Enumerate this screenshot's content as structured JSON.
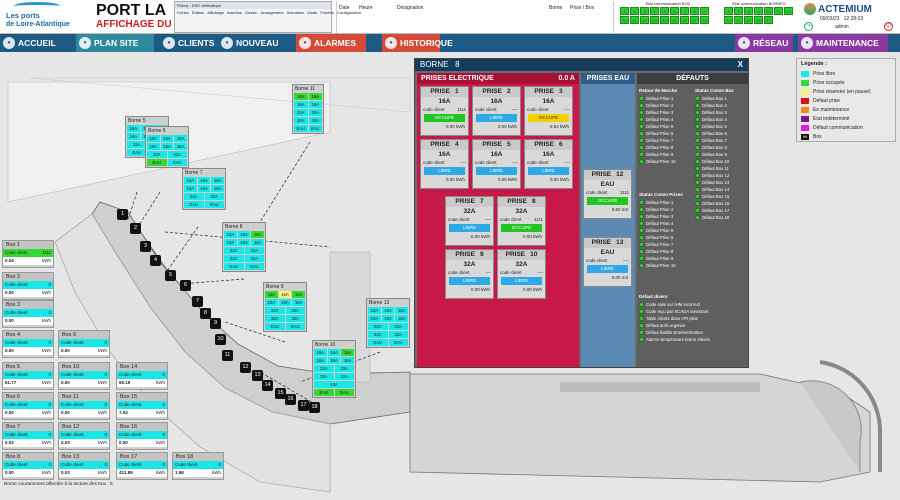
{
  "header": {
    "logo_line1": "Les ports",
    "logo_line2": "de Loire-Atlantique",
    "title": "PORT LA",
    "subtitle": "AFFICHAGE DU",
    "appwin_title": "RView - ERC Méthalique",
    "appwin_menu": [
      "Fichier",
      "Edition",
      "Affichage",
      "Insertion",
      "Dessin",
      "Arrangement",
      "Animation",
      "Mode",
      "Fenêtre",
      "Configuration"
    ],
    "cols": [
      "Date",
      "Heure",
      "Désignation",
      "Borne",
      "Prise / Box"
    ],
    "etat_box_label": "Etat communication BOX",
    "etat_bornes_label": "Etat communication BORNES",
    "box_nums": [
      "1",
      "2",
      "3",
      "4",
      "5",
      "6",
      "7",
      "8",
      "9",
      "10",
      "11",
      "12",
      "13",
      "14",
      "15",
      "16",
      "17",
      "18"
    ],
    "borne_nums": [
      "6",
      "7",
      "8",
      "9",
      "10",
      "11",
      "12",
      "13",
      "14",
      "15",
      "16",
      "17"
    ],
    "brand": "ACTEMIUM",
    "date": "09/03/23",
    "time": "12:28:03",
    "user": "admin"
  },
  "nav": [
    {
      "label": "ACCUEIL",
      "icon": "home-icon"
    },
    {
      "label": "PLAN SITE",
      "icon": "globe-icon"
    },
    {
      "label": "CLIENTS",
      "icon": "users-icon"
    },
    {
      "label": "NOUVEAU",
      "icon": "add-user-icon"
    },
    {
      "label": "ALARMES",
      "icon": "bell-icon"
    },
    {
      "label": "HISTORIQUE",
      "icon": "database-icon"
    },
    {
      "label": "RÉSEAU",
      "icon": "network-icon"
    },
    {
      "label": "MAINTENANCE",
      "icon": "wrench-icon"
    }
  ],
  "bornes": [
    {
      "name": "Borne 11",
      "rows": [
        [
          "16A",
          "16A"
        ],
        [
          "16A",
          "16A"
        ],
        [
          "32A",
          "32A"
        ],
        [
          "32A",
          "32A"
        ],
        [
          "EAU",
          "EAU"
        ]
      ],
      "colors": [
        [
          "gr",
          "gr"
        ],
        [
          "cy",
          "cy"
        ],
        [
          "cy",
          "cy"
        ],
        [
          "cy",
          "cy"
        ],
        [
          "cy",
          "cy"
        ]
      ]
    },
    {
      "name": "Borne 5",
      "rows": [
        [
          "16A",
          "16A",
          "16A"
        ],
        [
          "16A",
          "16A",
          "16A"
        ],
        [
          "32A",
          "32A"
        ],
        [
          "EAU",
          "EAU"
        ]
      ],
      "colors": [
        [
          "cy",
          "cy",
          "cy"
        ],
        [
          "cy",
          "cy",
          "cy"
        ],
        [
          "cy",
          "cy"
        ],
        [
          "cy",
          "cy"
        ]
      ]
    },
    {
      "name": "Borne 6",
      "rows": [
        [
          "16A",
          "16A",
          "16A"
        ],
        [
          "16A",
          "16A",
          "16A"
        ],
        [
          "32A",
          "32A"
        ],
        [
          "EAU",
          "EAU"
        ]
      ],
      "colors": [
        [
          "cy",
          "cy",
          "cy"
        ],
        [
          "cy",
          "cy",
          "cy"
        ],
        [
          "cy",
          "cy"
        ],
        [
          "gr",
          "cy"
        ]
      ]
    },
    {
      "name": "Borne 7",
      "rows": [
        [
          "16A",
          "16A",
          "16A"
        ],
        [
          "16A",
          "16A",
          "16A"
        ],
        [
          "32A",
          "32A"
        ],
        [
          "EAU",
          "EAU"
        ]
      ],
      "colors": [
        [
          "cy",
          "cy",
          "cy"
        ],
        [
          "cy",
          "cy",
          "cy"
        ],
        [
          "cy",
          "cy"
        ],
        [
          "cy",
          "cy"
        ]
      ]
    },
    {
      "name": "Borne 8",
      "rows": [
        [
          "16A",
          "16A",
          "16A"
        ],
        [
          "16A",
          "16A",
          "16A"
        ],
        [
          "32A",
          "32A"
        ],
        [
          "32A",
          "32A"
        ],
        [
          "EAU",
          "EAU"
        ]
      ],
      "colors": [
        [
          "cy",
          "cy",
          "gr"
        ],
        [
          "cy",
          "cy",
          "cy"
        ],
        [
          "cy",
          "cy"
        ],
        [
          "cy",
          "cy"
        ],
        [
          "cy",
          "cy"
        ]
      ]
    },
    {
      "name": "Borne 9",
      "rows": [
        [
          "16A",
          "16A",
          "16A"
        ],
        [
          "16A",
          "16A",
          "16A"
        ],
        [
          "32A",
          "32A"
        ],
        [
          "32A",
          "32A"
        ],
        [
          "EAU",
          "EAU"
        ]
      ],
      "colors": [
        [
          "gr",
          "yl",
          "gr"
        ],
        [
          "cy",
          "cy",
          "cy"
        ],
        [
          "cy",
          "cy"
        ],
        [
          "cy",
          "cy"
        ],
        [
          "cy",
          "cy"
        ]
      ]
    },
    {
      "name": "Borne 10",
      "rows": [
        [
          "16A",
          "16A",
          "16A"
        ],
        [
          "16A",
          "16A",
          "16A"
        ],
        [
          "32A",
          "32A"
        ],
        [
          "32A",
          "32A"
        ],
        [
          "63A"
        ],
        [
          "EAU",
          "EAU"
        ]
      ],
      "colors": [
        [
          "cy",
          "cy",
          "gr"
        ],
        [
          "cy",
          "cy",
          "cy"
        ],
        [
          "cy",
          "cy"
        ],
        [
          "cy",
          "cy"
        ],
        [
          "cy"
        ],
        [
          "gr",
          "gr"
        ]
      ]
    },
    {
      "name": "Borne 13",
      "rows": [
        [
          "16A",
          "16A",
          "16A"
        ],
        [
          "16A",
          "16A",
          "16A"
        ],
        [
          "32A",
          "32A"
        ],
        [
          "32A",
          "32A"
        ],
        [
          "EAU",
          "EAU"
        ]
      ],
      "colors": [
        [
          "cy",
          "cy",
          "cy"
        ],
        [
          "cy",
          "cy",
          "cy"
        ],
        [
          "cy",
          "cy"
        ],
        [
          "cy",
          "cy"
        ],
        [
          "cy",
          "cy"
        ]
      ]
    }
  ],
  "map_nums": [
    "1",
    "2",
    "3",
    "4",
    "5",
    "6",
    "7",
    "8",
    "9",
    "10",
    "11",
    "12",
    "13",
    "14",
    "15",
    "16",
    "17",
    "18"
  ],
  "boxes": [
    {
      "name": "Box 1",
      "code": "1111",
      "val": "0.04",
      "unit": "kWh",
      "green": true
    },
    {
      "name": "Box 2",
      "code": "0",
      "val": "0.00",
      "unit": "kWh"
    },
    {
      "name": "Box 3",
      "code": "0",
      "val": "0.00",
      "unit": "kWh"
    },
    {
      "name": "Box 4",
      "code": "0",
      "val": "0.00",
      "unit": "kWh"
    },
    {
      "name": "Box 9",
      "code": "0",
      "val": "0.00",
      "unit": "kWh"
    },
    {
      "name": "Box 5",
      "code": "0",
      "val": "61.77",
      "unit": "kWh"
    },
    {
      "name": "Box 10",
      "code": "0",
      "val": "0.00",
      "unit": "kWh"
    },
    {
      "name": "Box 14",
      "code": "0",
      "val": "65.19",
      "unit": "kWh"
    },
    {
      "name": "Box 6",
      "code": "0",
      "val": "0.00",
      "unit": "kWh"
    },
    {
      "name": "Box 11",
      "code": "0",
      "val": "0.00",
      "unit": "kWh"
    },
    {
      "name": "Box 15",
      "code": "0",
      "val": "7.04",
      "unit": "kWh"
    },
    {
      "name": "Box 7",
      "code": "0",
      "val": "0.02",
      "unit": "kWh"
    },
    {
      "name": "Box 12",
      "code": "0",
      "val": "2.03",
      "unit": "kWh"
    },
    {
      "name": "Box 16",
      "code": "0",
      "val": "0.00",
      "unit": "kWh"
    },
    {
      "name": "Box 8",
      "code": "0",
      "val": "0.00",
      "unit": "kWh"
    },
    {
      "name": "Box 13",
      "code": "0",
      "val": "0.03",
      "unit": "kWh"
    },
    {
      "name": "Box 17",
      "code": "0",
      "val": "421.89",
      "unit": "kWh"
    },
    {
      "name": "Box 18",
      "code": "0",
      "val": "1.98",
      "unit": "kWh"
    }
  ],
  "code_label": "Code client",
  "panel": {
    "title": "BORNE",
    "num": "8",
    "close": "X",
    "pe_title": "PRISES ELECTRIQUE",
    "pe_amp": "0.0 A",
    "eau_title": "PRISES EAU",
    "def_title": "DÉFAUTS",
    "prises": [
      {
        "name": "PRISE",
        "n": "1",
        "amp": "16A",
        "code": "1111",
        "state": "OCCUPÉ",
        "st": "ok",
        "kwh": "0.00 kWh"
      },
      {
        "name": "PRISE",
        "n": "2",
        "amp": "16A",
        "code": "----",
        "state": "LIBRE",
        "st": "bl",
        "kwh": "0.00 kWh"
      },
      {
        "name": "PRISE",
        "n": "3",
        "amp": "16A",
        "code": "----",
        "state": "OCCUPÉ",
        "st": "oc",
        "kwh": "8.84 kWh"
      },
      {
        "name": "PRISE",
        "n": "4",
        "amp": "16A",
        "code": "----",
        "state": "LIBRE",
        "st": "bl",
        "kwh": "0.00 kWh"
      },
      {
        "name": "PRISE",
        "n": "5",
        "amp": "16A",
        "code": "----",
        "state": "LIBRE",
        "st": "bl",
        "kwh": "0.00 kWh"
      },
      {
        "name": "PRISE",
        "n": "6",
        "amp": "16A",
        "code": "----",
        "state": "LIBRE",
        "st": "bl",
        "kwh": "0.00 kWh"
      },
      {
        "name": "PRISE",
        "n": "7",
        "amp": "32A",
        "code": "----",
        "state": "LIBRE",
        "st": "bl",
        "kwh": "0.00 kWh"
      },
      {
        "name": "PRISE",
        "n": "8",
        "amp": "32A",
        "code": "1111",
        "state": "OCCUPÉ",
        "st": "ok",
        "kwh": "0.00 kWh"
      },
      {
        "name": "PRISE",
        "n": "9",
        "amp": "32A",
        "code": "----",
        "state": "LIBRE",
        "st": "bl",
        "kwh": "0.00 kWh"
      },
      {
        "name": "PRISE",
        "n": "10",
        "amp": "32A",
        "code": "----",
        "state": "LIBRE",
        "st": "bl",
        "kwh": "0.00 kWh"
      }
    ],
    "eau": [
      {
        "name": "PRISE",
        "n": "12",
        "type": "EAU",
        "code": "1111",
        "state": "OCCUPÉ",
        "st": "ok",
        "m3": "0.82 m3"
      },
      {
        "name": "PRISE",
        "n": "13",
        "type": "EAU",
        "code": "----",
        "state": "LIBRE",
        "st": "bl",
        "m3": "0.00 m3"
      }
    ],
    "rm_title": "Retour de Marche",
    "scb_title": "Status Comm Box",
    "scp_title": "Status Comm Prises",
    "dd_title": "Défaut divers",
    "rm": [
      "Défaut Prise 1",
      "Défaut Prise 2",
      "Défaut Prise 3",
      "Défaut Prise 4",
      "Défaut Prise 5",
      "Défaut Prise 6",
      "Défaut Prise 7",
      "Défaut Prise 8",
      "Défaut Prise 9",
      "Défaut Prise 10"
    ],
    "scb": [
      "Défaut Box 1",
      "Défaut Box 2",
      "Défaut Box 3",
      "Défaut Box 4",
      "Défaut Box 5",
      "Défaut Box 6",
      "Défaut Box 7",
      "Défaut Box 8",
      "Défaut Box 9",
      "Défaut Box 10",
      "Défaut Box 11",
      "Défaut Box 12",
      "Défaut Box 13",
      "Défaut Box 14",
      "Défaut Box 15",
      "Défaut Box 16",
      "Défaut Box 17",
      "Défaut Box 18"
    ],
    "scp": [
      "Défaut Prise 1",
      "Défaut Prise 2",
      "Défaut Prise 3",
      "Défaut Prise 4",
      "Défaut Prise 5",
      "Défaut Prise 6",
      "Défaut Prise 7",
      "Défaut Prise 8",
      "Défaut Prise 9",
      "Défaut Prise 10"
    ],
    "dd": [
      "Code saisi sur IHM incorrect",
      "Code reçu par SCADA inexistant",
      "Table clients dans API plein",
      "Défaut arrêt urgence",
      "Défaut fusible Entrées/Sorties",
      "Alarme température borne élevée"
    ]
  },
  "legend": {
    "title": "Légende :",
    "items": [
      {
        "label": "Prise libre",
        "color": "#19e6e6"
      },
      {
        "label": "Prise occupée",
        "color": "#35d735"
      },
      {
        "label": "Prise réservée (en pause)",
        "color": "#f3f37a"
      },
      {
        "label": "Défaut prise",
        "color": "#e01010"
      },
      {
        "label": "En maintenance",
        "color": "#f08a1a"
      },
      {
        "label": "Etat indéterminé",
        "color": "#7a1a8a"
      },
      {
        "label": "Défaut communication",
        "color": "#e61ad8"
      },
      {
        "label": "Box",
        "color": "#111",
        "text": "99"
      }
    ]
  },
  "footer": "Borne couramment affectée à la lecture des box : 5"
}
